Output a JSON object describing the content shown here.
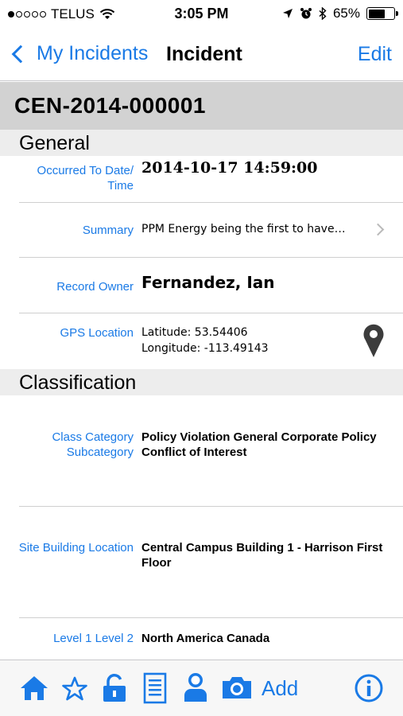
{
  "status_bar": {
    "carrier": "TELUS",
    "time": "3:05 PM",
    "battery": "65%",
    "battery_level": 0.65
  },
  "nav": {
    "back_label": "My Incidents",
    "title": "Incident",
    "edit_label": "Edit"
  },
  "record": {
    "id": "CEN-2014-000001"
  },
  "sections": {
    "general": "General",
    "classification": "Classification"
  },
  "general": {
    "occurred_label_line1": "Occurred To Date/",
    "occurred_label_line2": "Time",
    "occurred_value": "2014-10-17 14:59:00",
    "summary_label": "Summary",
    "summary_value": "PPM Energy being the first to have…",
    "owner_label": "Record Owner",
    "owner_value": "Fernandez, Ian",
    "gps_label": "GPS Location",
    "gps_latitude": "Latitude: 53.54406",
    "gps_longitude": "Longitude: -113.49143"
  },
  "classification": {
    "class_label": "Class",
    "class_value": "Policy Violation",
    "category_label": "Category",
    "category_value": "General Corporate Policy",
    "subcategory_label": "Subcategory",
    "subcategory_value": "Conflict of Interest",
    "site_label": "Site",
    "site_value": "Central Campus",
    "building_label": "Building",
    "building_value": "Building 1 - Harrison",
    "location_label": "Location",
    "location_value": "First Floor",
    "level1_label": "Level 1",
    "level1_value": "North America",
    "level2_label": "Level 2",
    "level2_value": "Canada"
  },
  "tab_bar": {
    "add_label": "Add",
    "icons": [
      "home-icon",
      "star-icon",
      "unlock-icon",
      "document-icon",
      "person-icon",
      "camera-icon",
      "info-icon"
    ]
  },
  "colors": {
    "accent": "#1a7ae6",
    "header_gray": "#d2d2d2",
    "section_gray": "#ededed"
  }
}
